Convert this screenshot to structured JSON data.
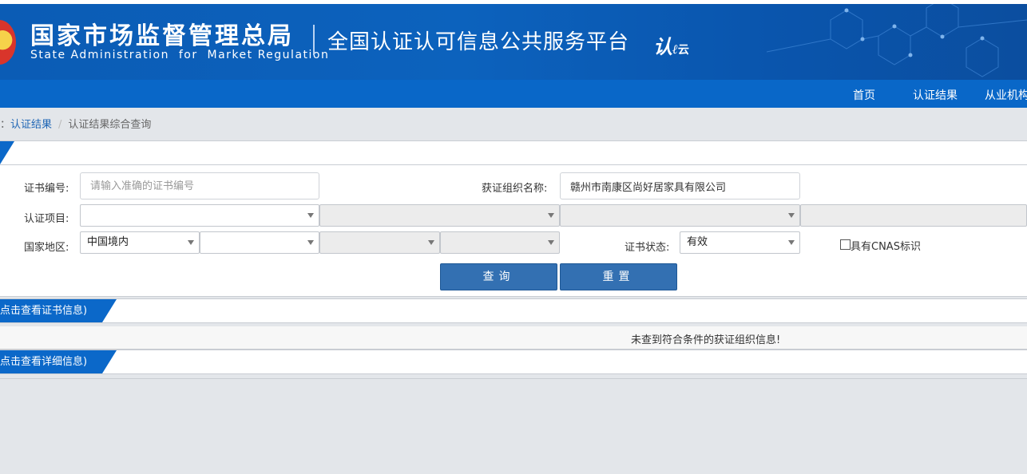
{
  "header": {
    "agency_cn": "国家市场监督管理总局",
    "agency_en": "State Administration  for  Market Regulation",
    "platform_title": "全国认证认可信息公共服务平台",
    "logo_text": "认",
    "logo_sub": "云"
  },
  "nav": {
    "items": [
      {
        "label": "首页"
      },
      {
        "label": "认证结果"
      },
      {
        "label": "从业机构"
      }
    ]
  },
  "breadcrumb": {
    "prefix": "：",
    "parent": "认证结果",
    "current": "认证结果综合查询"
  },
  "form": {
    "cert_no_label": "证书编号:",
    "cert_no_placeholder": "请输入准确的证书编号",
    "org_name_label": "获证组织名称:",
    "org_name_value": "赣州市南康区尚好居家具有限公司",
    "project_label": "认证项目:",
    "region_label": "国家地区:",
    "region_value": "中国境内",
    "status_label": "证书状态:",
    "status_value": "有效",
    "cnas_label": "具有CNAS标识",
    "search_button": "查询",
    "reset_button": "重置"
  },
  "sections": {
    "cert_info_tab": "点击查看证书信息)",
    "detail_info_tab": "点击查看详细信息)",
    "no_result_message": "未查到符合条件的获证组织信息!"
  },
  "colors": {
    "brand_blue": "#0b5cb5",
    "nav_blue": "#0967c8",
    "button_blue": "#3370b2"
  }
}
